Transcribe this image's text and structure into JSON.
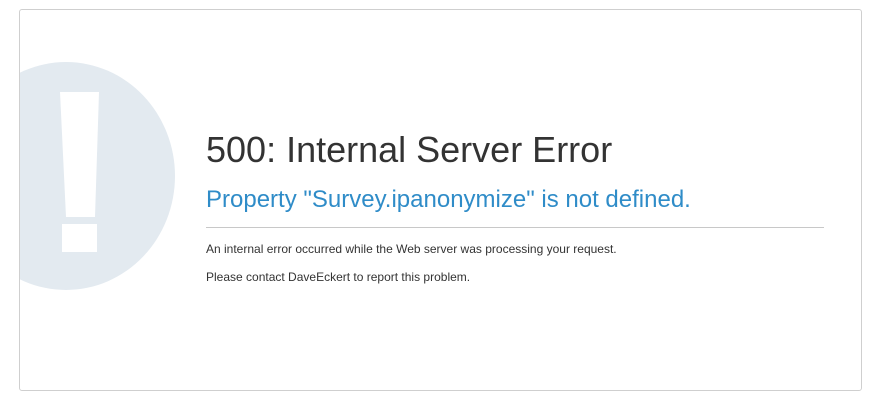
{
  "error": {
    "code_title": "500: Internal Server Error",
    "detail": "Property \"Survey.ipanonymize\" is not defined.",
    "message_1": "An internal error occurred while the Web server was processing your request.",
    "message_2": "Please contact DaveEckert to report this problem."
  },
  "icons": {
    "background_icon": "exclamation-icon"
  },
  "colors": {
    "title": "#333333",
    "detail": "#2f8cc8",
    "icon_circle": "#e3eaf0",
    "border": "#cfcfcf"
  }
}
